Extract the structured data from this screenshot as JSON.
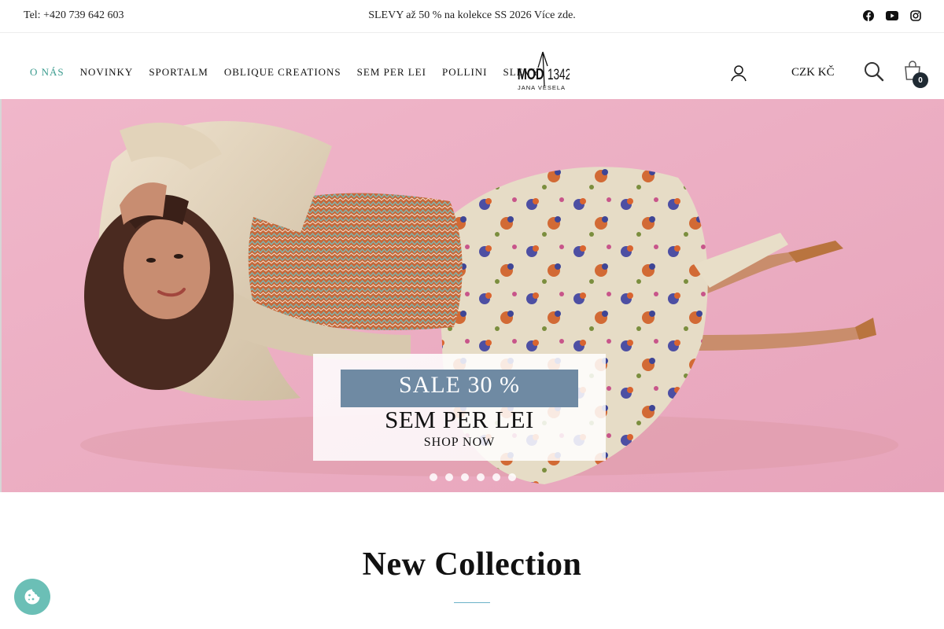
{
  "topbar": {
    "phone": "Tel: +420 739 642 603",
    "promo": "SLEVY až 50 % na kolekce SS 2026 Více zde.",
    "social": [
      "facebook-icon",
      "youtube-icon",
      "instagram-icon"
    ]
  },
  "header": {
    "nav": [
      {
        "label": "O NÁS",
        "active": true
      },
      {
        "label": "NOVINKY"
      },
      {
        "label": "SPORTALM"
      },
      {
        "label": "OBLIQUE CREATIONS"
      },
      {
        "label": "SEM PER LEI"
      },
      {
        "label": "POLLINI"
      },
      {
        "label": "SLEVY"
      }
    ],
    "logo": {
      "main": "MODA 1342",
      "sub": "JANA VESELA"
    },
    "currency": "CZK KČ",
    "cart_count": "0"
  },
  "hero": {
    "sale": "SALE 30 %",
    "brand": "SEM PER LEI",
    "cta": "SHOP NOW",
    "slide_count": 6,
    "background_color": "#ebadc2"
  },
  "section": {
    "title": "New Collection"
  },
  "colors": {
    "accent": "#3b9b8e",
    "sale_banner": "#6f8aa3",
    "cookie": "#6bbfb6",
    "badge": "#1f2a33"
  }
}
